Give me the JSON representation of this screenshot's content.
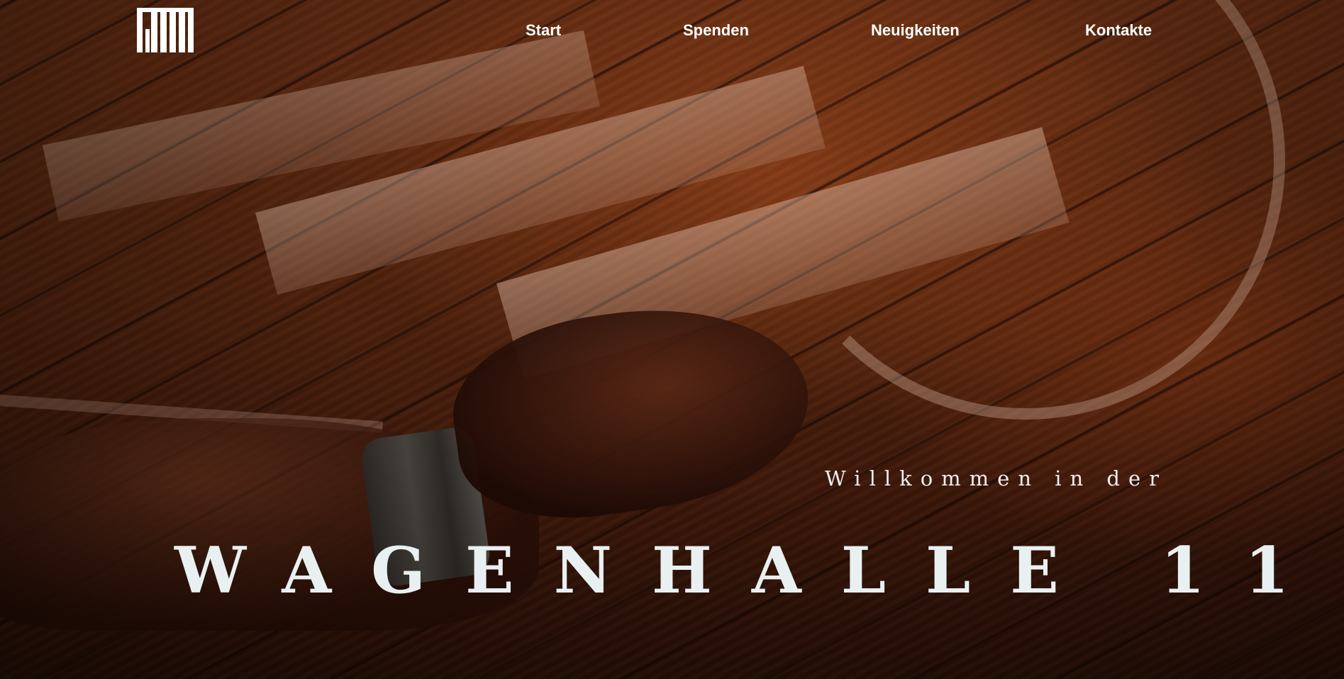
{
  "nav": {
    "logo_icon": "wagenhalle-logo-icon",
    "items": [
      {
        "label": "Start"
      },
      {
        "label": "Spenden"
      },
      {
        "label": "Neuigkeiten"
      },
      {
        "label": "Kontakte"
      }
    ]
  },
  "hero": {
    "welcome": "Willkommen in der",
    "title": "WAGENHALLE 11",
    "background_image": "wooden-floor-hand-photo"
  },
  "colors": {
    "text": "#ffffff",
    "title": "#e9f0f1",
    "background": "#4a200d"
  }
}
